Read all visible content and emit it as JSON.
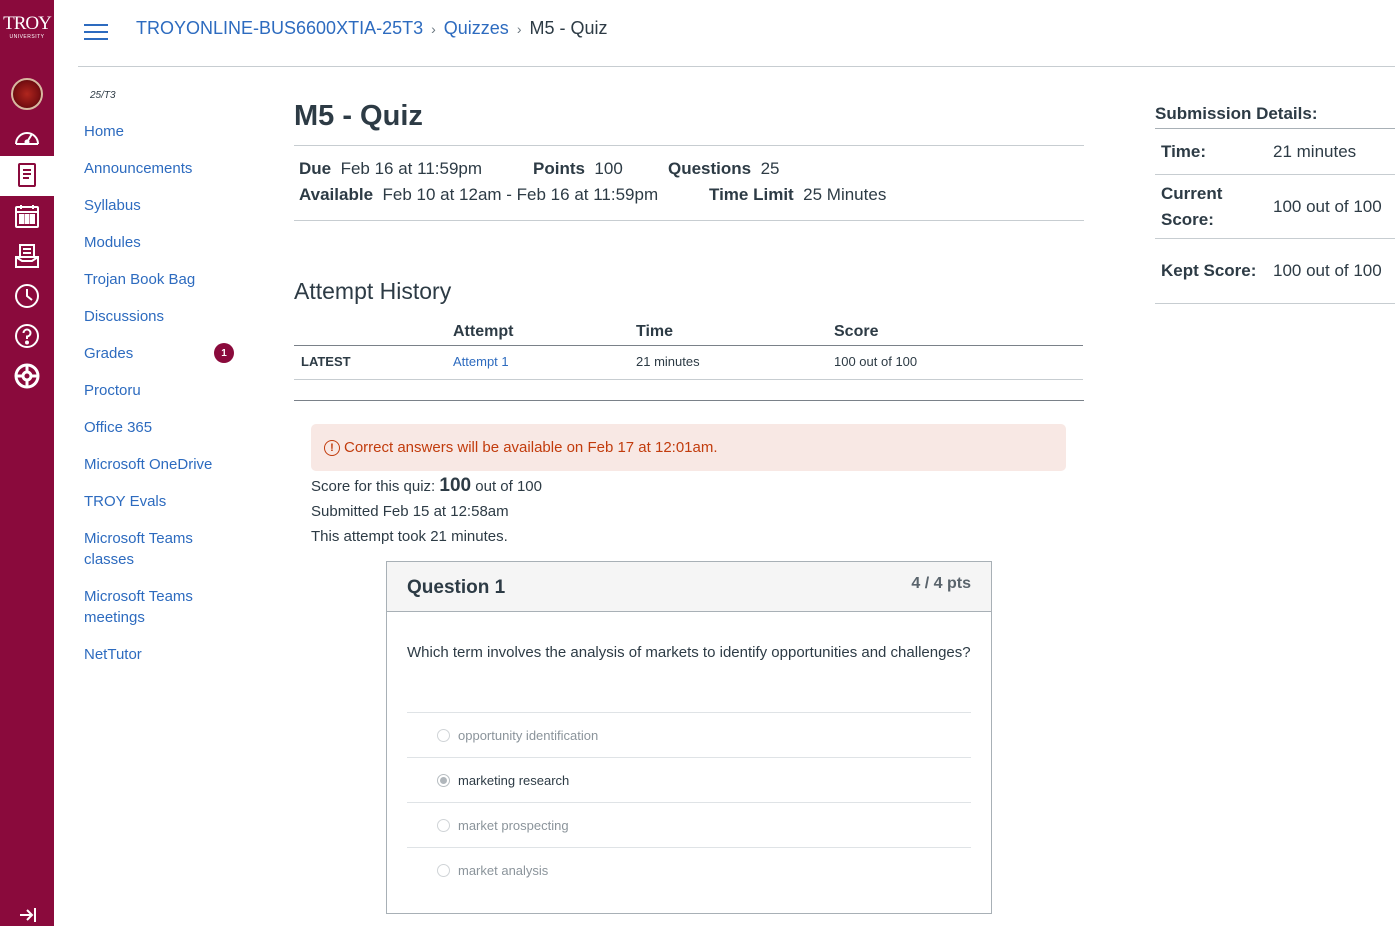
{
  "brand": {
    "logo_line1": "TROY",
    "logo_line2": "UNIVERSITY",
    "primary_color": "#8a0a3c",
    "link_color": "#2d6bbf"
  },
  "global_nav": {
    "items": [
      "account-avatar",
      "dashboard-icon",
      "courses-icon",
      "calendar-icon",
      "inbox-icon",
      "history-icon",
      "help-icon",
      "commons-icon"
    ],
    "active": "courses-icon"
  },
  "breadcrumbs": {
    "course": "TROYONLINE-BUS6600XTIA-25T3",
    "section": "Quizzes",
    "current": "M5 - Quiz"
  },
  "course_nav": {
    "term": "25/T3",
    "items": [
      {
        "label": "Home"
      },
      {
        "label": "Announcements"
      },
      {
        "label": "Syllabus"
      },
      {
        "label": "Modules"
      },
      {
        "label": "Trojan Book Bag"
      },
      {
        "label": "Discussions"
      },
      {
        "label": "Grades",
        "badge": "1"
      },
      {
        "label": "Proctoru"
      },
      {
        "label": "Office 365"
      },
      {
        "label": "Microsoft OneDrive"
      },
      {
        "label": "TROY Evals"
      },
      {
        "label": "Microsoft Teams classes"
      },
      {
        "label": "Microsoft Teams meetings"
      },
      {
        "label": "NetTutor"
      }
    ]
  },
  "quiz": {
    "title": "M5 - Quiz",
    "due_label": "Due",
    "due": "Feb 16 at 11:59pm",
    "points_label": "Points",
    "points": "100",
    "questions_label": "Questions",
    "questions": "25",
    "available_label": "Available",
    "available": "Feb 10 at 12am - Feb 16 at 11:59pm",
    "time_limit_label": "Time Limit",
    "time_limit": "25 Minutes"
  },
  "attempt_history": {
    "heading": "Attempt History",
    "columns": [
      "",
      "Attempt",
      "Time",
      "Score"
    ],
    "rows": [
      {
        "tag": "LATEST",
        "attempt": "Attempt 1",
        "time": "21 minutes",
        "score": "100 out of 100"
      }
    ]
  },
  "notice": {
    "icon": "!",
    "text": "Correct answers will be available on Feb 17 at 12:01am."
  },
  "score_info": {
    "score_prefix": "Score for this quiz:",
    "score": "100",
    "score_suffix": "out of 100",
    "submitted": "Submitted Feb 15 at 12:58am",
    "duration": "This attempt took 21 minutes."
  },
  "question": {
    "title": "Question 1",
    "points": "4 / 4 pts",
    "text": "Which term involves the analysis of markets to identify opportunities and challenges?",
    "answers": [
      {
        "label": "opportunity identification",
        "selected": false
      },
      {
        "label": "marketing research",
        "selected": true
      },
      {
        "label": "market prospecting",
        "selected": false
      },
      {
        "label": "market analysis",
        "selected": false
      }
    ]
  },
  "submission_details": {
    "heading": "Submission Details:",
    "time_label": "Time:",
    "time": "21 minutes",
    "current_label": "Current Score:",
    "current": "100 out of 100",
    "kept_label": "Kept Score:",
    "kept": "100 out of 100"
  }
}
